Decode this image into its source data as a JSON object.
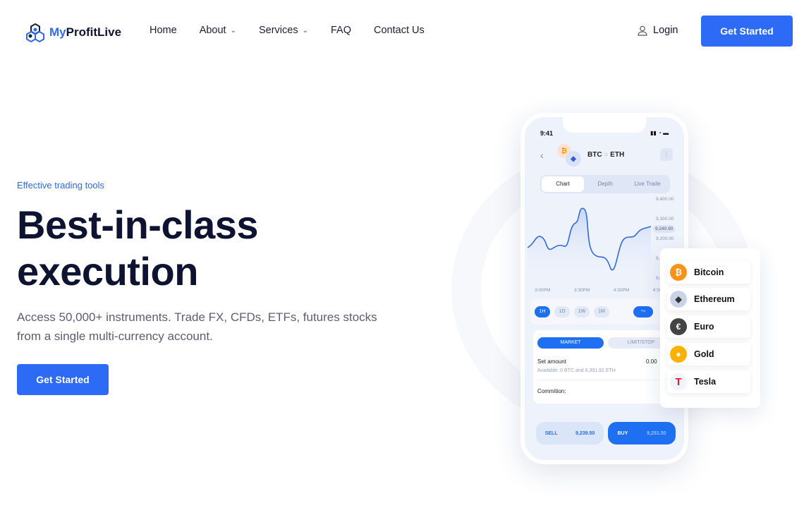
{
  "brand": {
    "part1": "My",
    "part2": "ProfitLive"
  },
  "nav": {
    "items": [
      {
        "label": "Home"
      },
      {
        "label": "About",
        "dropdown": true
      },
      {
        "label": "Services",
        "dropdown": true
      },
      {
        "label": "FAQ"
      },
      {
        "label": "Contact Us"
      }
    ],
    "login": "Login",
    "cta": "Get Started"
  },
  "hero": {
    "eyebrow": "Effective trading tools",
    "title_line1": "Best-in-class",
    "title_line2": "execution",
    "description": "Access 50,000+ instruments. Trade FX, CFDs, ETFs, futures stocks from a single multi-currency account.",
    "cta": "Get Started"
  },
  "phone": {
    "time": "9:41",
    "pair_base": "BTC",
    "pair_quote": "ETH",
    "tabs": [
      "Chart",
      "Depth",
      "Live Trade"
    ],
    "y_ticks": [
      "9,400.00",
      "9,300.00",
      "9,200.00",
      "9,1",
      "9,0"
    ],
    "current_price": "9,240.90",
    "x_ticks": [
      "3:00PM",
      "3:30PM",
      "4:30PM",
      "4:30PM"
    ],
    "ranges": [
      "1H",
      "1D",
      "1W",
      "1M"
    ],
    "order_tabs": [
      "MARKET",
      "LIMIT/STOP"
    ],
    "set_amount_label": "Set amount",
    "set_amount_value": "0.00",
    "available": "Available: 0 BTC and 6,391.92 ETH",
    "commission": "Commition:",
    "sell_label": "SELL",
    "sell_price": "9,239.50",
    "buy_label": "BUY",
    "buy_price": "9,251.50"
  },
  "assets": [
    {
      "name": "Bitcoin",
      "icon": "bitcoin-icon",
      "color": "#f7931a"
    },
    {
      "name": "Ethereum",
      "icon": "ethereum-icon",
      "color": "#c9d3e6"
    },
    {
      "name": "Euro",
      "icon": "euro-icon",
      "color": "#444444"
    },
    {
      "name": "Gold",
      "icon": "gold-icon",
      "color": "#f9b200"
    },
    {
      "name": "Tesla",
      "icon": "tesla-icon",
      "color": "#e31937"
    }
  ],
  "colors": {
    "accent": "#2d6bf6",
    "dark": "#0d1330"
  }
}
